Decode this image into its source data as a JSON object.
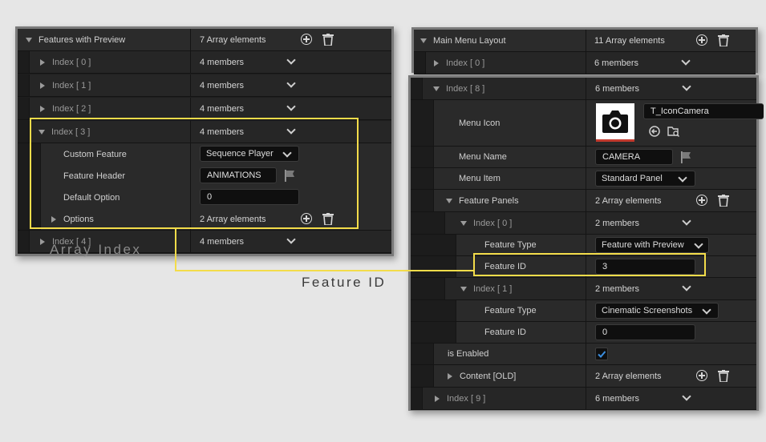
{
  "left_panel": {
    "title": "Features with Preview",
    "count": "7 Array elements",
    "items": [
      {
        "label": "Index [ 0 ]",
        "value": "4 members"
      },
      {
        "label": "Index [ 1 ]",
        "value": "4 members"
      },
      {
        "label": "Index [ 2 ]",
        "value": "4 members"
      },
      {
        "label": "Index [ 3 ]",
        "value": "4 members"
      },
      {
        "label": "Index [ 4 ]",
        "value": "4 members"
      }
    ],
    "fields": {
      "custom_feature_label": "Custom Feature",
      "custom_feature_value": "Sequence Player",
      "feature_header_label": "Feature Header",
      "feature_header_value": "ANIMATIONS",
      "default_option_label": "Default Option",
      "default_option_value": "0",
      "options_label": "Options",
      "options_value": "2 Array elements"
    }
  },
  "right_top": {
    "title": "Main Menu Layout",
    "count": "11 Array elements",
    "index0_label": "Index [ 0 ]",
    "index0_value": "6 members"
  },
  "right_main": {
    "index8_label": "Index [ 8 ]",
    "index8_value": "6 members",
    "menu_icon_label": "Menu Icon",
    "menu_icon_asset": "T_IconCamera",
    "menu_name_label": "Menu Name",
    "menu_name_value": "CAMERA",
    "menu_item_label": "Menu Item",
    "menu_item_value": "Standard Panel",
    "feature_panels_label": "Feature Panels",
    "feature_panels_value": "2 Array elements",
    "fp0_label": "Index [ 0 ]",
    "fp0_value": "2 members",
    "fp0_type_label": "Feature Type",
    "fp0_type_value": "Feature with Preview",
    "fp0_id_label": "Feature ID",
    "fp0_id_value": "3",
    "fp1_label": "Index [ 1 ]",
    "fp1_value": "2 members",
    "fp1_type_label": "Feature Type",
    "fp1_type_value": "Cinematic Screenshots",
    "fp1_id_label": "Feature ID",
    "fp1_id_value": "0",
    "enabled_label": "is Enabled",
    "enabled_checked": true,
    "content_label": "Content [OLD]",
    "content_value": "2 Array elements",
    "index9_label": "Index [ 9 ]",
    "index9_value": "6 members"
  },
  "annotations": {
    "array_index": "Array Index",
    "feature_id": "Feature ID"
  },
  "colors": {
    "highlight": "#f3dc4a",
    "check_accent": "#3b8fe0",
    "panel_bg": "#1e1e1e"
  }
}
